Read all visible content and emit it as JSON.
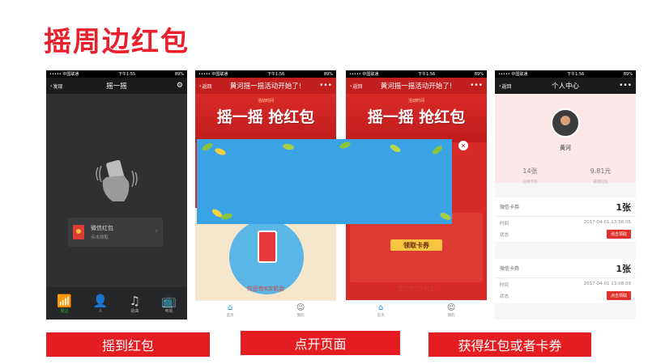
{
  "title": "摇周边红包",
  "status": {
    "carrier": "••••• 中国联通",
    "time1": "下午1:55",
    "time2": "下午1:56",
    "battery": "89%"
  },
  "phone1": {
    "back": "发现",
    "nav_title": "摇一摇",
    "card_title": "微信红包",
    "card_sub": "点击领取",
    "tabs": [
      {
        "label": "周边",
        "icon": "📶"
      },
      {
        "label": "人",
        "icon": "👤"
      },
      {
        "label": "歌曲",
        "icon": "♫"
      },
      {
        "label": "电视",
        "icon": "📺"
      }
    ]
  },
  "phone2": {
    "back": "返回",
    "nav_title": "黄河摇一摇活动开始了!",
    "hero_sub": "活动时间",
    "hero_title": "摇一摇 抢红包",
    "chances": "你还有8次机会",
    "tabs": [
      {
        "label": "首页",
        "icon": "⌂"
      },
      {
        "label": "我的",
        "icon": "☺"
      }
    ]
  },
  "phone3": {
    "back": "返回",
    "nav_title": "黄河摇一摇活动开始了!",
    "hero_sub": "活动时间",
    "hero_title": "摇一摇 抢红包",
    "coupon_btn": "领取卡券",
    "chances": "您还有7次机会",
    "tabs": [
      {
        "label": "首页",
        "icon": "⌂"
      },
      {
        "label": "我的",
        "icon": "☺"
      }
    ]
  },
  "phone4": {
    "back": "返回",
    "nav_title": "个人中心",
    "name": "黄河",
    "stats": [
      {
        "num": "14张",
        "label": "已领卡券"
      },
      {
        "num": "9.81元",
        "label": "获得红包"
      }
    ],
    "cards": [
      {
        "type": "微信卡券",
        "count": "1张",
        "time_label": "时间",
        "time": "2017-04-01 13:56:05",
        "state_label": "状态",
        "action": "点击领取"
      },
      {
        "type": "微信卡券",
        "count": "1张",
        "time_label": "时间",
        "time": "2017-04-01 13:08:09",
        "state_label": "状态",
        "action": "点击领取"
      }
    ]
  },
  "captions": [
    "摇到红包",
    "点开页面",
    "获得红包或者卡券"
  ]
}
